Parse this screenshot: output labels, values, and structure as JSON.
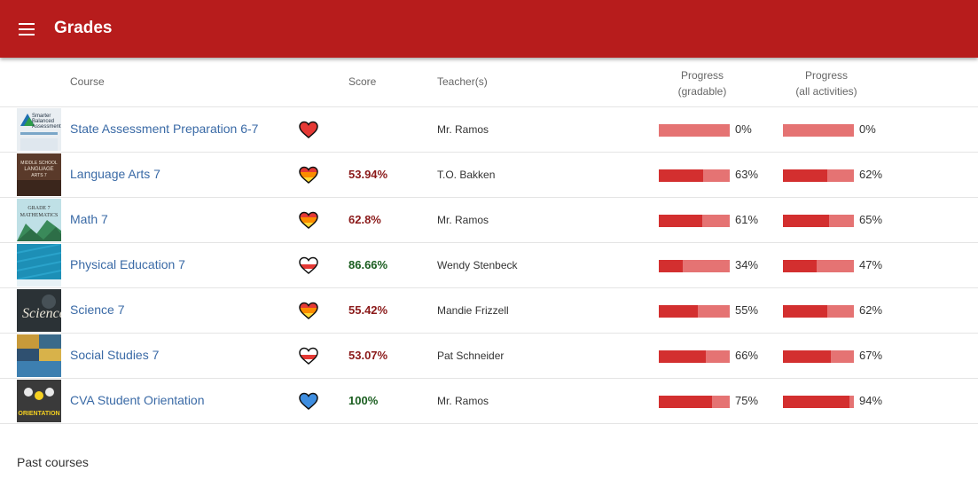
{
  "app": {
    "title": "Grades",
    "menu_icon": "hamburger-menu-icon",
    "bar_color": "#b71c1c"
  },
  "columns": {
    "course": "Course",
    "score": "Score",
    "teacher": "Teacher(s)",
    "progress_gradable": [
      "Progress",
      "(gradable)"
    ],
    "progress_all": [
      "Progress",
      "(all activities)"
    ]
  },
  "colors": {
    "score_red": "#8b1a1a",
    "score_green": "#1b5e20",
    "link": "#3a6aa6",
    "bar_fill": "#d32f2f",
    "bar_track": "#e57373"
  },
  "courses": [
    {
      "name": "State Assessment Preparation 6-7",
      "heart": "red",
      "score": "",
      "score_color": "red",
      "teacher": "Mr. Ramos",
      "gradable": 0,
      "gradable_label": "0%",
      "all": 0,
      "all_label": "0%",
      "thumb": "smarter-balanced-thumbnail"
    },
    {
      "name": "Language Arts 7",
      "heart": "orange",
      "score": "53.94%",
      "score_color": "red",
      "teacher": "T.O. Bakken",
      "gradable": 63,
      "gradable_label": "63%",
      "all": 62,
      "all_label": "62%",
      "thumb": "language-arts-thumbnail"
    },
    {
      "name": "Math 7",
      "heart": "orange",
      "score": "62.8%",
      "score_color": "red",
      "teacher": "Mr. Ramos",
      "gradable": 61,
      "gradable_label": "61%",
      "all": 65,
      "all_label": "65%",
      "thumb": "math-thumbnail"
    },
    {
      "name": "Physical Education 7",
      "heart": "white-red",
      "score": "86.66%",
      "score_color": "green",
      "teacher": "Wendy Stenbeck",
      "gradable": 34,
      "gradable_label": "34%",
      "all": 47,
      "all_label": "47%",
      "thumb": "physical-education-thumbnail"
    },
    {
      "name": "Science 7",
      "heart": "orange",
      "score": "55.42%",
      "score_color": "red",
      "teacher": "Mandie Frizzell",
      "gradable": 55,
      "gradable_label": "55%",
      "all": 62,
      "all_label": "62%",
      "thumb": "science-thumbnail"
    },
    {
      "name": "Social Studies 7",
      "heart": "white-red",
      "score": "53.07%",
      "score_color": "red",
      "teacher": "Pat Schneider",
      "gradable": 66,
      "gradable_label": "66%",
      "all": 67,
      "all_label": "67%",
      "thumb": "social-studies-thumbnail"
    },
    {
      "name": "CVA Student Orientation",
      "heart": "blue",
      "score": "100%",
      "score_color": "green",
      "teacher": "Mr. Ramos",
      "gradable": 75,
      "gradable_label": "75%",
      "all": 94,
      "all_label": "94%",
      "thumb": "orientation-thumbnail"
    }
  ],
  "thumb_text": {
    "smarter": [
      "Smarter",
      "Balanced",
      "Assessment"
    ],
    "language": [
      "MIDDLE SCHOOL",
      "LANGUAGE",
      "ARTS 7"
    ],
    "math": [
      "GRADE 7",
      "MATHEMATICS"
    ],
    "science": "Science",
    "orientation": "ORIENTATION"
  },
  "footer": {
    "past_courses": "Past courses"
  }
}
